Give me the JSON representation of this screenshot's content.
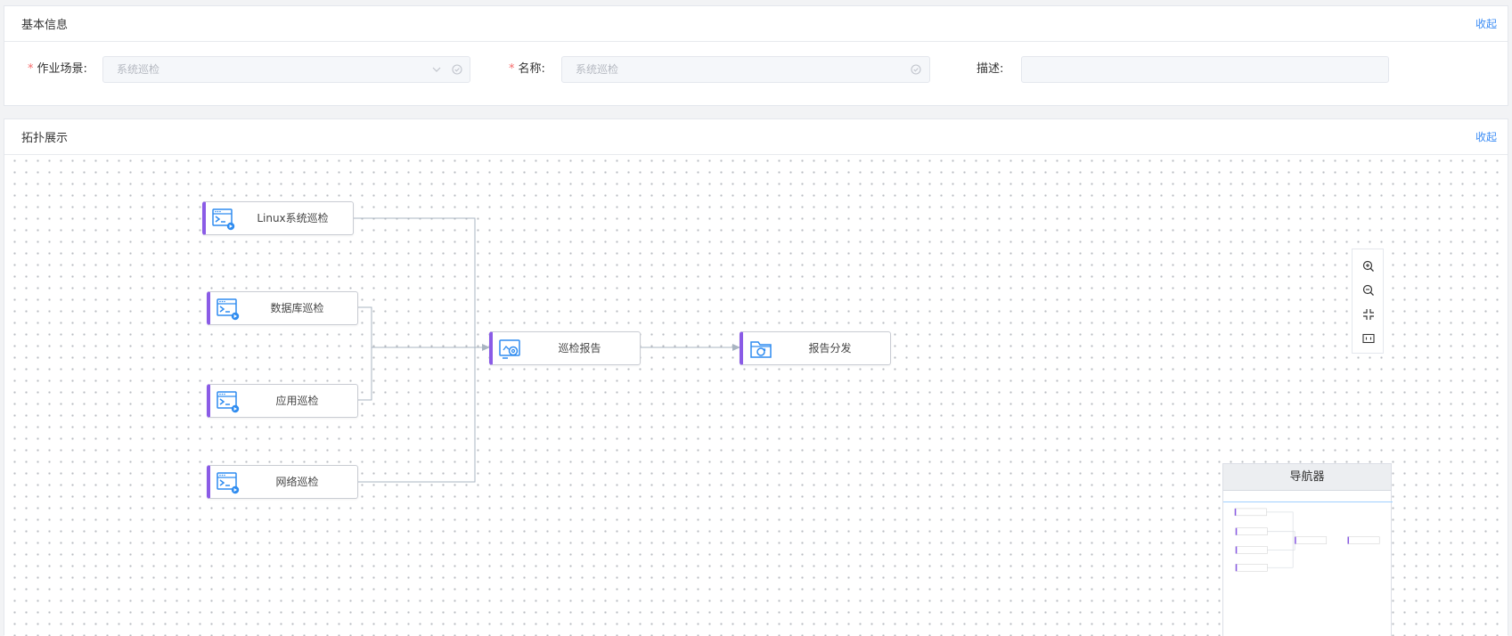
{
  "basic_info": {
    "title": "基本信息",
    "collapse_label": "收起",
    "scene_label": "作业场景:",
    "scene_value": "系统巡检",
    "name_label": "名称:",
    "name_value": "系统巡检",
    "desc_label": "描述:",
    "desc_value": "",
    "required_mark": "*"
  },
  "topology": {
    "title": "拓扑展示",
    "collapse_label": "收起",
    "nodes": {
      "linux": "Linux系统巡检",
      "database": "数据库巡检",
      "application": "应用巡检",
      "network": "网络巡检",
      "report": "巡检报告",
      "distribute": "报告分发"
    },
    "zoom_tools": [
      "zoom-in-icon",
      "zoom-out-icon",
      "fit-view-icon",
      "actual-size-icon"
    ],
    "minimap_title": "导航器"
  },
  "colors": {
    "accent": "#8a5be6",
    "link": "#3b8cf5",
    "icon": "#2f8cf0",
    "edge": "#a9b4c2"
  }
}
